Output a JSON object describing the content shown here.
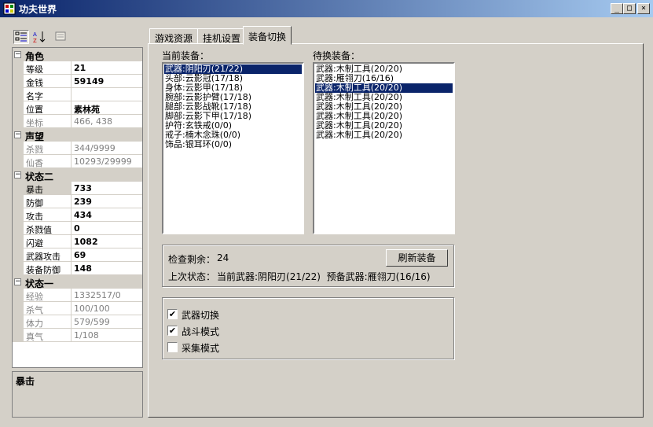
{
  "window": {
    "title": "功夫世界",
    "controls": [
      "_",
      "□",
      "×"
    ]
  },
  "propgrid": {
    "categories": [
      {
        "label": "角色",
        "rows": [
          {
            "name": "等级",
            "value": "21",
            "bold": true,
            "ro": false
          },
          {
            "name": "金钱",
            "value": "59149",
            "bold": true,
            "ro": false
          },
          {
            "name": "名字",
            "value": "",
            "bold": false,
            "ro": false
          },
          {
            "name": "位置",
            "value": "素林苑",
            "bold": true,
            "ro": false
          },
          {
            "name": "坐标",
            "value": "466, 438",
            "bold": false,
            "ro": true
          }
        ]
      },
      {
        "label": "声望",
        "rows": [
          {
            "name": "杀戮",
            "value": "344/9999",
            "bold": false,
            "ro": true
          },
          {
            "name": "仙香",
            "value": "10293/29999",
            "bold": false,
            "ro": true
          }
        ]
      },
      {
        "label": "状态二",
        "rows": [
          {
            "name": "暴击",
            "value": "733",
            "bold": true,
            "ro": false
          },
          {
            "name": "防御",
            "value": "239",
            "bold": true,
            "ro": false
          },
          {
            "name": "攻击",
            "value": "434",
            "bold": true,
            "ro": false
          },
          {
            "name": "杀戮值",
            "value": "0",
            "bold": true,
            "ro": false
          },
          {
            "name": "闪避",
            "value": "1082",
            "bold": true,
            "ro": false
          },
          {
            "name": "武器攻击",
            "value": "69",
            "bold": true,
            "ro": false
          },
          {
            "name": "装备防御",
            "value": "148",
            "bold": true,
            "ro": false
          }
        ]
      },
      {
        "label": "状态一",
        "rows": [
          {
            "name": "经验",
            "value": "1332517/0",
            "bold": false,
            "ro": true
          },
          {
            "name": "杀气",
            "value": "100/100",
            "bold": false,
            "ro": true
          },
          {
            "name": "体力",
            "value": "579/599",
            "bold": false,
            "ro": true
          },
          {
            "name": "真气",
            "value": "1/108",
            "bold": false,
            "ro": true
          }
        ]
      }
    ],
    "description_title": "暴击"
  },
  "tabs": [
    {
      "label": "游戏资源"
    },
    {
      "label": "挂机设置"
    },
    {
      "label": "装备切换"
    }
  ],
  "equip": {
    "current_label": "当前装备：",
    "current_items": [
      "武器:阴阳刃(21/22)",
      "头部:云影冠(17/18)",
      "身体:云影甲(17/18)",
      "腕部:云影护臂(17/18)",
      "腿部:云影战靴(17/18)",
      "脚部:云影下甲(17/18)",
      "护符:玄铁戒(0/0)",
      "戒子:楠木念珠(0/0)",
      "饰品:银耳环(0/0)"
    ],
    "pending_label": "待换装备：",
    "pending_items": [
      "武器:木制工具(20/20)",
      "武器:雁翎刀(16/16)",
      "武器:木制工具(20/20)",
      "武器:木制工具(20/20)",
      "武器:木制工具(20/20)",
      "武器:木制工具(20/20)",
      "武器:木制工具(20/20)",
      "武器:木制工具(20/20)"
    ],
    "check_label": "检查剩余：",
    "check_value": "24",
    "refresh_button": "刷新装备",
    "last_status_label": "上次状态：",
    "last_status_text": "当前武器:阴阳刃(21/22)  预备武器:雁翎刀(16/16)",
    "options": [
      {
        "label": "武器切换",
        "checked": true
      },
      {
        "label": "战斗模式",
        "checked": true
      },
      {
        "label": "采集模式",
        "checked": false
      }
    ]
  }
}
